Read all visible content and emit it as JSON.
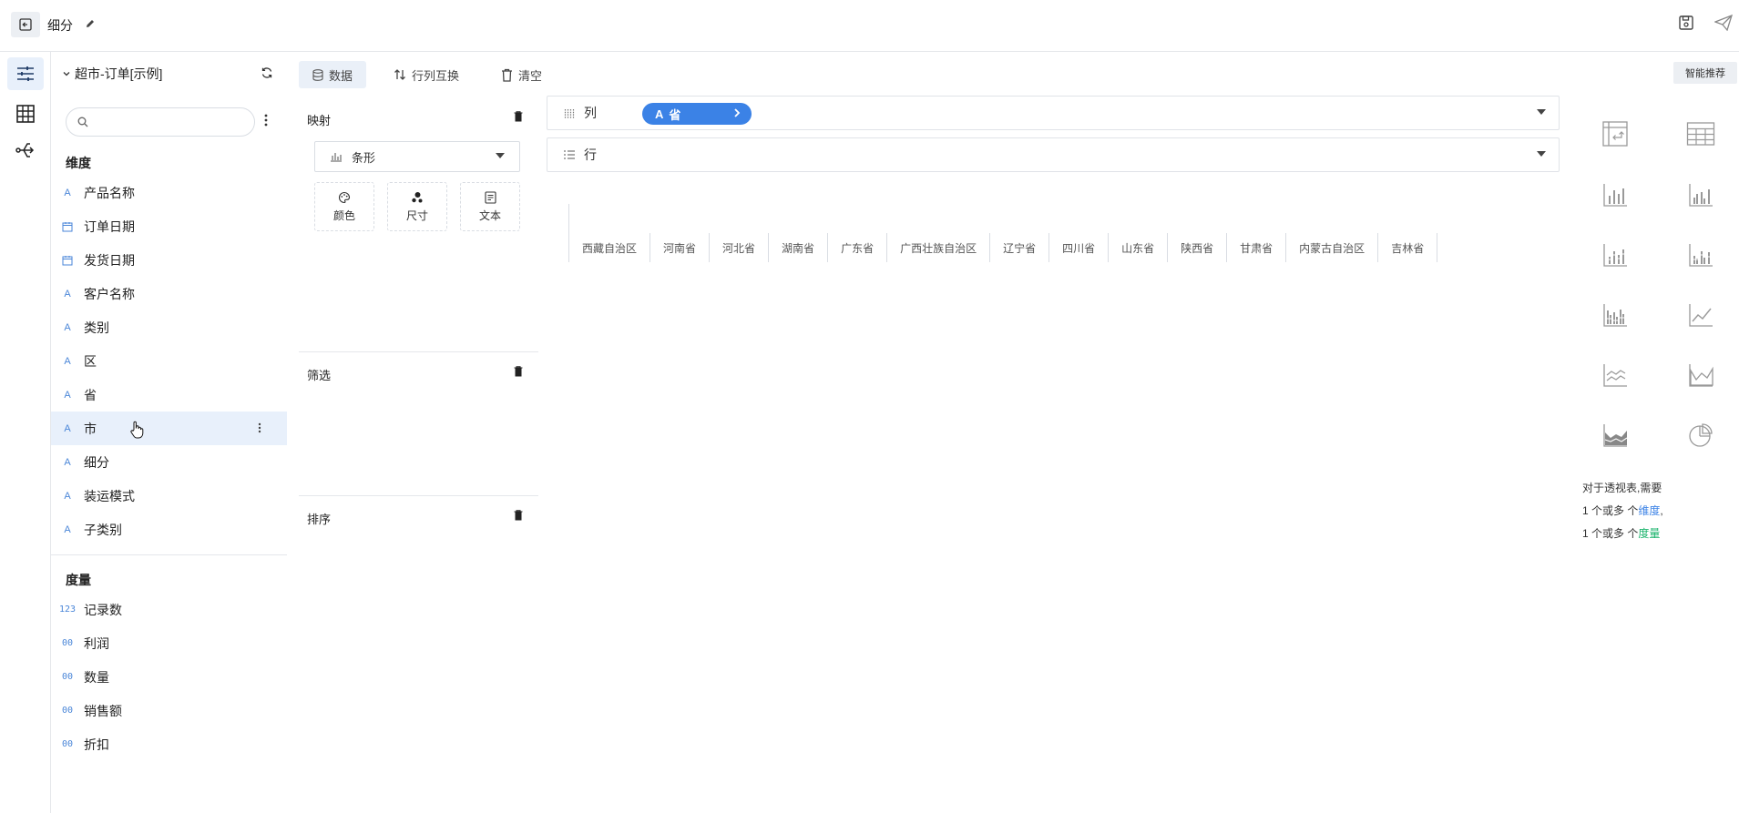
{
  "header": {
    "title": "细分"
  },
  "dataset": {
    "name": "超市-订单[示例]"
  },
  "search": {
    "placeholder": "",
    "value": ""
  },
  "dimensions": {
    "title": "维度",
    "items": [
      {
        "type": "A",
        "label": "产品名称"
      },
      {
        "type": "date",
        "label": "订单日期"
      },
      {
        "type": "date",
        "label": "发货日期"
      },
      {
        "type": "A",
        "label": "客户名称"
      },
      {
        "type": "A",
        "label": "类别"
      },
      {
        "type": "A",
        "label": "区"
      },
      {
        "type": "A",
        "label": "省"
      },
      {
        "type": "A",
        "label": "市"
      },
      {
        "type": "A",
        "label": "细分"
      },
      {
        "type": "A",
        "label": "装运模式"
      },
      {
        "type": "A",
        "label": "子类别"
      }
    ]
  },
  "measures": {
    "title": "度量",
    "items": [
      {
        "type": "123",
        "label": "记录数"
      },
      {
        "type": "00",
        "label": "利润"
      },
      {
        "type": "00",
        "label": "数量"
      },
      {
        "type": "00",
        "label": "销售额"
      },
      {
        "type": "00",
        "label": "折扣"
      }
    ]
  },
  "toolbar": {
    "data_label": "数据",
    "swap_label": "行列互换",
    "clear_label": "清空"
  },
  "mapping": {
    "title": "映射",
    "chart_type": "条形",
    "buttons": {
      "color": "颜色",
      "size": "尺寸",
      "text": "文本"
    }
  },
  "filter": {
    "title": "筛选"
  },
  "sort": {
    "title": "排序"
  },
  "columns_shelf": {
    "label": "列",
    "pill_type": "A",
    "pill_label": "省"
  },
  "rows_shelf": {
    "label": "行"
  },
  "pivot_header": [
    "西藏自治区",
    "河南省",
    "河北省",
    "湖南省",
    "广东省",
    "广西壮族自治区",
    "辽宁省",
    "四川省",
    "山东省",
    "陕西省",
    "甘肃省",
    "内蒙古自治区",
    "吉林省"
  ],
  "smart_recommend": "智能推荐",
  "hint": {
    "line1": "对于透视表,需要",
    "line2_prefix": "1 个或多 个",
    "line2_term": "维度",
    "line2_suffix": ",",
    "line3_prefix": "1 个或多 个",
    "line3_term": "度量"
  },
  "colors": {
    "accent": "#3b82e6",
    "active_bg": "#e8f0fb",
    "green": "#19b36b"
  }
}
